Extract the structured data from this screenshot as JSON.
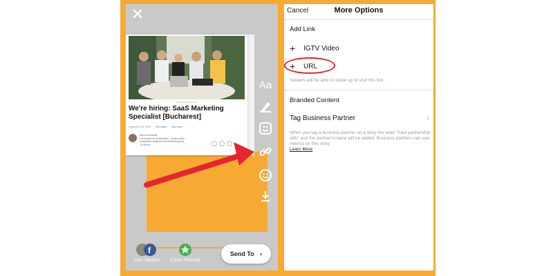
{
  "colors": {
    "frame": "#f7aa33",
    "arrow": "#e52532",
    "highlight": "#e2202a",
    "accent_link": "#3a7bd5"
  },
  "left_panel": {
    "close_icon": "close-icon",
    "article": {
      "source_caption": "www.loremipsum.com",
      "headline": "We're hiring: SaaS Marketing Specialist [Bucharest]",
      "meta": {
        "date": "September 30, 2019",
        "edit": "Edit article",
        "stats": "View stats"
      },
      "author": {
        "name": "Alina Constantin",
        "line1": "Co-founder of Socialinsider - social media",
        "line2": "competitive analysis & benchmarking tool",
        "followers": "18 articles"
      }
    },
    "tools": [
      "text-tool-icon",
      "pen-icon",
      "sticker-icon",
      "link-icon",
      "face-sticker-icon",
      "download-icon"
    ],
    "tool_text": "Aa",
    "bottom": {
      "your_stories": "Your Stories",
      "close_friends": "Close Friends",
      "send_to": "Send To"
    }
  },
  "right_panel": {
    "nav": {
      "cancel": "Cancel",
      "title": "More Options"
    },
    "add_link": {
      "heading": "Add Link",
      "igtv": "IGTV Video",
      "url": "URL",
      "hint": "Viewers will be able to swipe up to visit this link."
    },
    "branded": {
      "heading": "Branded Content",
      "tag_partner": "Tag Business Partner",
      "desc": "When you tag a business partner on a story the label \"Paid partnership with\" and the partner's name will be added. Business partners can see metrics on this story.",
      "learn_more": "Learn More"
    }
  }
}
